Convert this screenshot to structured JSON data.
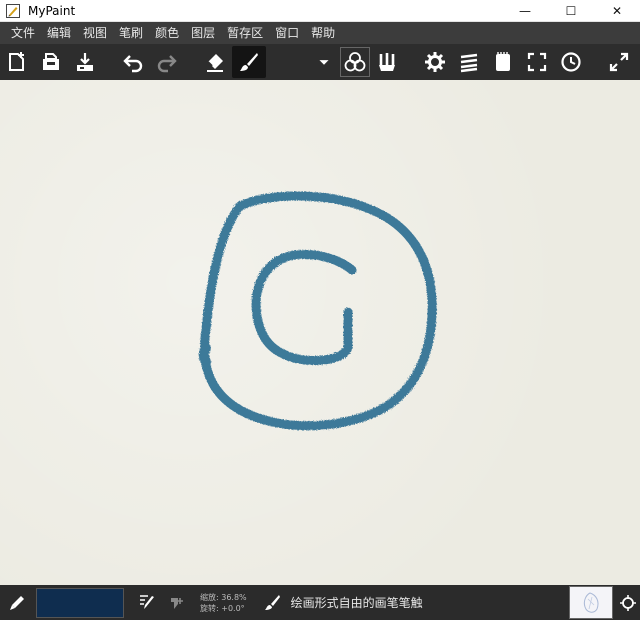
{
  "window": {
    "title": "MyPaint",
    "minimize": "—",
    "maximize": "☐",
    "close": "✕"
  },
  "menu": [
    "文件",
    "编辑",
    "视图",
    "笔刷",
    "颜色",
    "图层",
    "暂存区",
    "窗口",
    "帮助"
  ],
  "toolbar": {
    "icons": [
      "new-document-icon",
      "open-file-icon",
      "save-icon",
      "undo-icon",
      "redo-icon",
      "eraser-icon",
      "brush-icon",
      "dropdown-arrow-icon",
      "color-circles-icon",
      "brush-set-icon",
      "settings-gear-icon",
      "layers-icon",
      "scratchpad-icon",
      "fullscreen-icon",
      "history-clock-icon",
      "expand-icon"
    ]
  },
  "canvas": {
    "background_color": "#ecebe2",
    "stroke_color": "#2f6f93"
  },
  "status": {
    "color_swatch": "#0f2d4f",
    "zoom": "缩放: 36.8%",
    "rotation": "旋转: +0.0°",
    "brush_description": "绘画形式自由的画笔笔触"
  }
}
